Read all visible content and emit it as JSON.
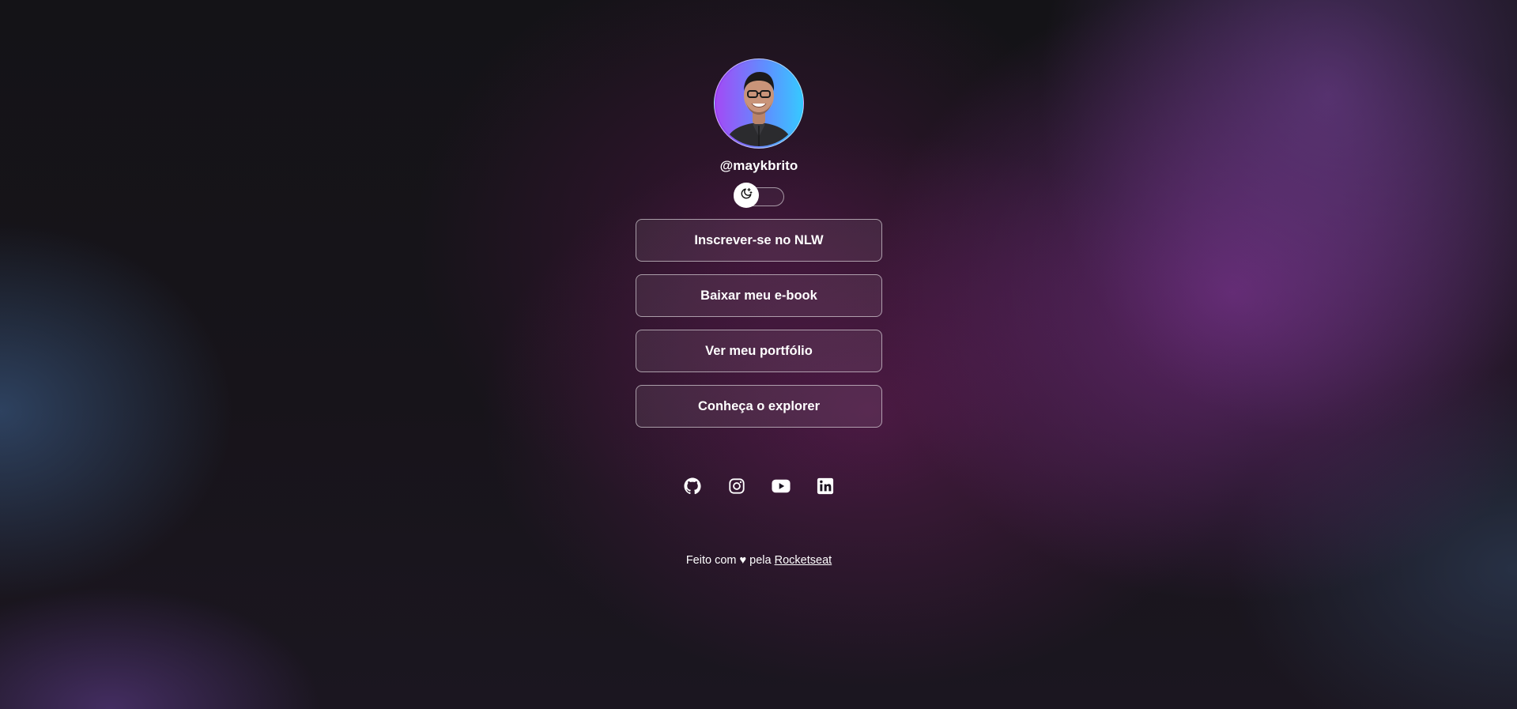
{
  "profile": {
    "username": "@maykbrito",
    "avatar_alt": "avatar"
  },
  "theme_switch": {
    "icon": "moon-stars-icon"
  },
  "links": [
    {
      "label": "Inscrever-se no NLW"
    },
    {
      "label": "Baixar meu e-book"
    },
    {
      "label": "Ver meu portfólio"
    },
    {
      "label": "Conheça o explorer"
    }
  ],
  "social": [
    {
      "icon": "github-icon"
    },
    {
      "icon": "instagram-icon"
    },
    {
      "icon": "youtube-icon"
    },
    {
      "icon": "linkedin-icon"
    }
  ],
  "footer": {
    "prefix": "Feito com",
    "heart": "♥",
    "middle": "pela",
    "link_label": "Rocketseat"
  },
  "colors": {
    "avatar_gradient_start": "#9b3df0",
    "avatar_gradient_end": "#33c6ff",
    "text": "#ffffff"
  }
}
